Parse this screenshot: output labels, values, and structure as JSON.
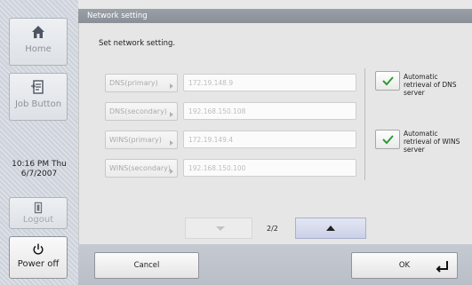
{
  "sidebar": {
    "home_label": "Home",
    "job_button_label": "Job Button",
    "time": "10:16 PM  Thu",
    "date": "6/7/2007",
    "logout_label": "Logout",
    "power_label": "Power off"
  },
  "panel": {
    "title": "Network setting",
    "instruction": "Set network setting."
  },
  "fields": {
    "dns_primary": {
      "label": "DNS(primary)",
      "value": "172.19.148.9"
    },
    "dns_secondary": {
      "label": "DNS(secondary)",
      "value": "192.168.150.108"
    },
    "wins_primary": {
      "label": "WINS(primary)",
      "value": "172.19.149.4"
    },
    "wins_secondary": {
      "label": "WINS(secondary)",
      "value": "192.168.150.100"
    }
  },
  "options": {
    "auto_dns": {
      "line1": "Automatic",
      "line2": "retrieval of DNS",
      "line3": "server",
      "checked": true
    },
    "auto_wins": {
      "line1": "Automatic",
      "line2": "retrieval of WINS",
      "line3": "server",
      "checked": true
    }
  },
  "pager": {
    "text": "2/2"
  },
  "actions": {
    "cancel": "Cancel",
    "ok": "OK"
  },
  "colors": {
    "check": "#2f9c2f",
    "title_bar": "#8f949c",
    "sidebar": "#cfd4dc"
  }
}
